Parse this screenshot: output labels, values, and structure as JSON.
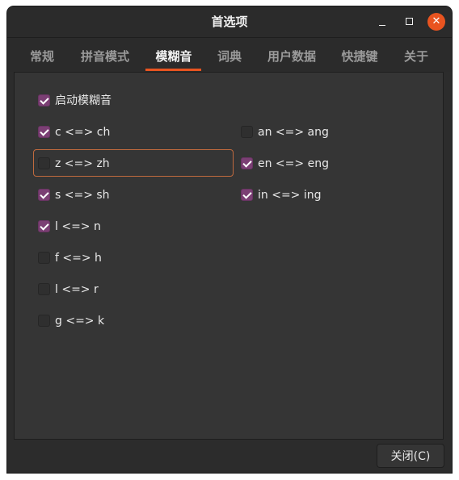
{
  "window": {
    "title": "首选项",
    "close_glyph": "✕"
  },
  "tabs": [
    {
      "label": "常规",
      "active": false
    },
    {
      "label": "拼音模式",
      "active": false
    },
    {
      "label": "模糊音",
      "active": true
    },
    {
      "label": "词典",
      "active": false
    },
    {
      "label": "用户数据",
      "active": false
    },
    {
      "label": "快捷键",
      "active": false
    },
    {
      "label": "关于",
      "active": false
    }
  ],
  "fuzzy": {
    "enable": {
      "label": "启动模糊音",
      "checked": true
    },
    "left": [
      {
        "label": "c <=> ch",
        "checked": true
      },
      {
        "label": "z <=> zh",
        "checked": false
      },
      {
        "label": "s <=> sh",
        "checked": true
      },
      {
        "label": "l <=> n",
        "checked": true
      },
      {
        "label": "f <=> h",
        "checked": false
      },
      {
        "label": "l <=> r",
        "checked": false
      },
      {
        "label": "g <=> k",
        "checked": false
      }
    ],
    "right": [
      {
        "label": "an <=> ang",
        "checked": false
      },
      {
        "label": "en <=> eng",
        "checked": true
      },
      {
        "label": "in <=> ing",
        "checked": true
      }
    ]
  },
  "footer": {
    "close_label": "关闭(C)"
  },
  "colors": {
    "accent": "#e95420",
    "checkbox_checked": "#7b3f74",
    "window_bg": "#2c2c2c",
    "panel_bg": "#353535"
  }
}
